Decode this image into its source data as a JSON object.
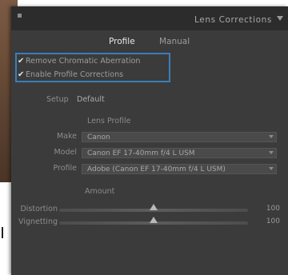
{
  "panel": {
    "title": "Lens Corrections"
  },
  "tabs": [
    {
      "label": "Profile",
      "active": true
    },
    {
      "label": "Manual",
      "active": false
    }
  ],
  "checkboxes": [
    {
      "label": "Remove Chromatic Aberration",
      "checked": true
    },
    {
      "label": "Enable Profile Corrections",
      "checked": true
    }
  ],
  "setup": {
    "label": "Setup",
    "value": "Default"
  },
  "lens_profile": {
    "heading": "Lens Profile",
    "fields": [
      {
        "label": "Make",
        "value": "Canon"
      },
      {
        "label": "Model",
        "value": "Canon EF 17-40mm f/4 L USM"
      },
      {
        "label": "Profile",
        "value": "Adobe (Canon EF 17-40mm f/4 L USM)"
      }
    ]
  },
  "amount": {
    "heading": "Amount",
    "sliders": [
      {
        "label": "Distortion",
        "value": "100",
        "level": 0.5
      },
      {
        "label": "Vignetting",
        "value": "100",
        "level": 0.5
      }
    ]
  },
  "colors": {
    "panel_bg": "#3b3b3b",
    "header_bg": "#2c2c2c",
    "highlight_border": "#3a7db8",
    "text": "#a9a9a9"
  }
}
